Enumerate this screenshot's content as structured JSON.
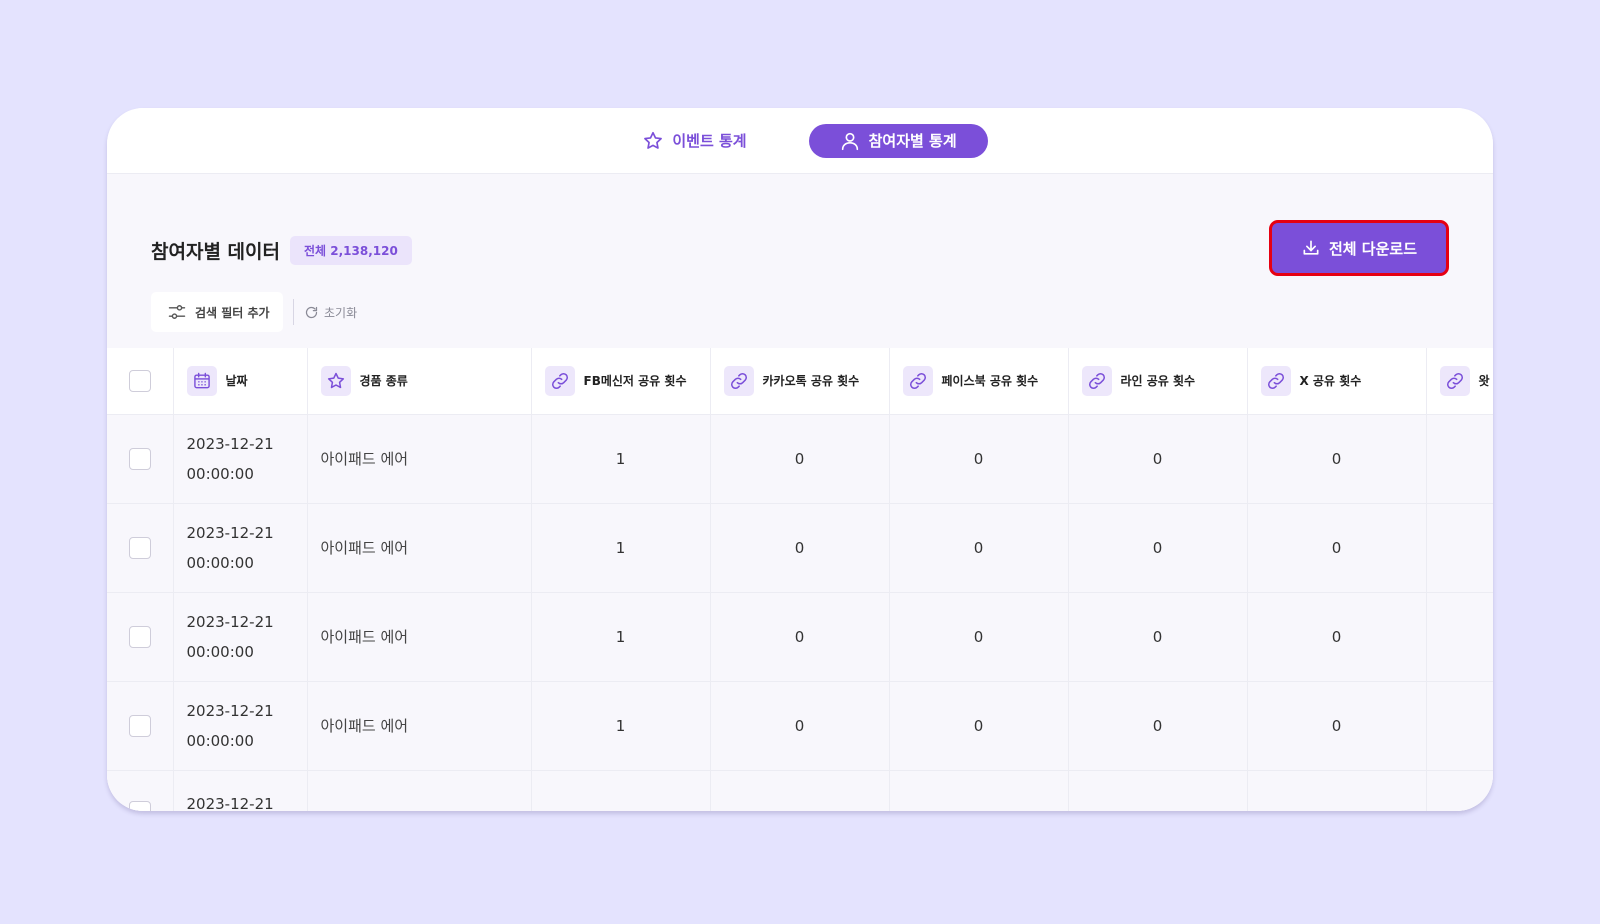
{
  "tabs": [
    {
      "label": "이벤트 통계",
      "icon": "star-icon",
      "active": false
    },
    {
      "label": "참여자별 통계",
      "icon": "user-icon",
      "active": true
    }
  ],
  "header": {
    "title": "참여자별 데이터",
    "count_badge": "전체 2,138,120",
    "download_label": "전체 다운로드"
  },
  "filters": {
    "add_filter_label": "검색 필터 추가",
    "reset_label": "초기화"
  },
  "table": {
    "columns": [
      {
        "label": "날짜",
        "icon": "calendar-icon"
      },
      {
        "label": "경품 종류",
        "icon": "star-icon"
      },
      {
        "label": "FB메신저 공유 횟수",
        "icon": "link-icon"
      },
      {
        "label": "카카오톡 공유 횟수",
        "icon": "link-icon"
      },
      {
        "label": "페이스북 공유 횟수",
        "icon": "link-icon"
      },
      {
        "label": "라인 공유 횟수",
        "icon": "link-icon"
      },
      {
        "label": "X 공유 횟수",
        "icon": "link-icon"
      },
      {
        "label": "왓",
        "icon": "link-icon"
      }
    ],
    "rows": [
      {
        "date": "2023-12-21",
        "time": "00:00:00",
        "prize": "아이패드 에어",
        "fb": "1",
        "kakao": "0",
        "facebook": "0",
        "line": "0",
        "x": "0"
      },
      {
        "date": "2023-12-21",
        "time": "00:00:00",
        "prize": "아이패드 에어",
        "fb": "1",
        "kakao": "0",
        "facebook": "0",
        "line": "0",
        "x": "0"
      },
      {
        "date": "2023-12-21",
        "time": "00:00:00",
        "prize": "아이패드 에어",
        "fb": "1",
        "kakao": "0",
        "facebook": "0",
        "line": "0",
        "x": "0"
      },
      {
        "date": "2023-12-21",
        "time": "00:00:00",
        "prize": "아이패드 에어",
        "fb": "1",
        "kakao": "0",
        "facebook": "0",
        "line": "0",
        "x": "0"
      }
    ],
    "partial_row": {
      "date": "2023-12-21"
    }
  },
  "colors": {
    "accent": "#7b4fd9",
    "background": "#e4e3fe",
    "highlight_border": "#e60012"
  }
}
